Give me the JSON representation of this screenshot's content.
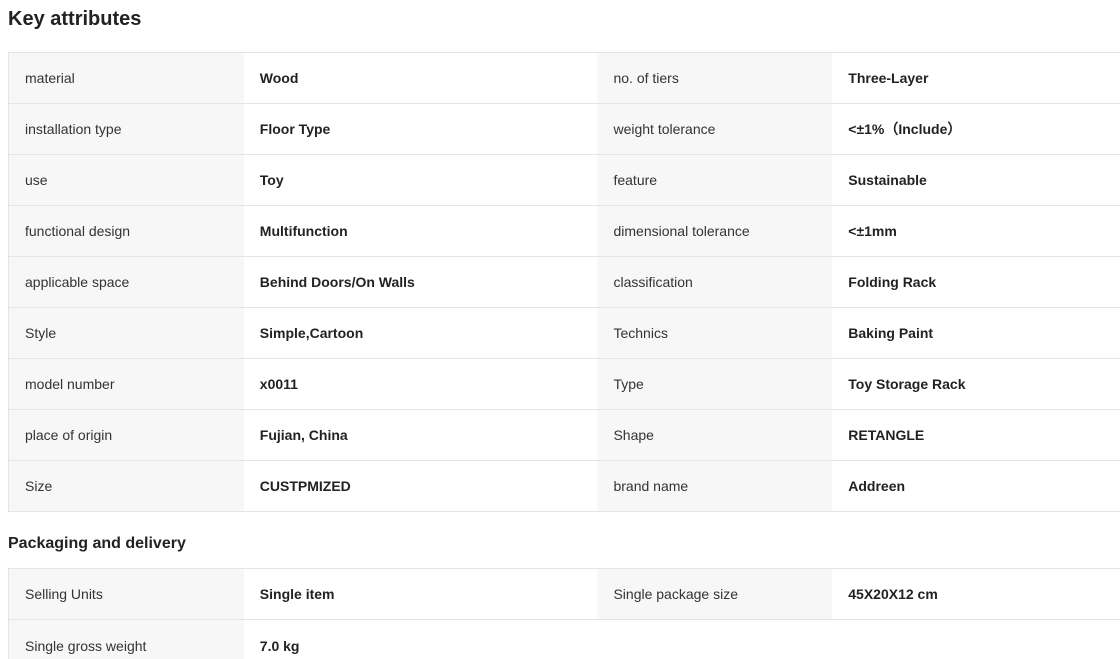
{
  "key_attributes": {
    "title": "Key attributes",
    "rows": [
      {
        "label1": "material",
        "value1": "Wood",
        "label2": "no. of tiers",
        "value2": "Three-Layer"
      },
      {
        "label1": "installation type",
        "value1": "Floor Type",
        "label2": "weight tolerance",
        "value2": "<±1%（Include）"
      },
      {
        "label1": "use",
        "value1": "Toy",
        "label2": "feature",
        "value2": "Sustainable"
      },
      {
        "label1": "functional design",
        "value1": "Multifunction",
        "label2": "dimensional tolerance",
        "value2": "<±1mm"
      },
      {
        "label1": "applicable space",
        "value1": "Behind Doors/On Walls",
        "label2": "classification",
        "value2": "Folding Rack"
      },
      {
        "label1": "Style",
        "value1": "Simple,Cartoon",
        "label2": "Technics",
        "value2": "Baking Paint"
      },
      {
        "label1": "model number",
        "value1": "x0011",
        "label2": "Type",
        "value2": "Toy Storage Rack"
      },
      {
        "label1": "place of origin",
        "value1": "Fujian, China",
        "label2": "Shape",
        "value2": "RETANGLE"
      },
      {
        "label1": "Size",
        "value1": "CUSTPMIZED",
        "label2": "brand name",
        "value2": "Addreen"
      }
    ]
  },
  "packaging": {
    "title": "Packaging and delivery",
    "rows": [
      {
        "label1": "Selling Units",
        "value1": "Single item",
        "label2": "Single package size",
        "value2": "45X20X12 cm"
      },
      {
        "label1": "Single gross weight",
        "value1": "7.0 kg",
        "label2": "",
        "value2": ""
      }
    ]
  }
}
